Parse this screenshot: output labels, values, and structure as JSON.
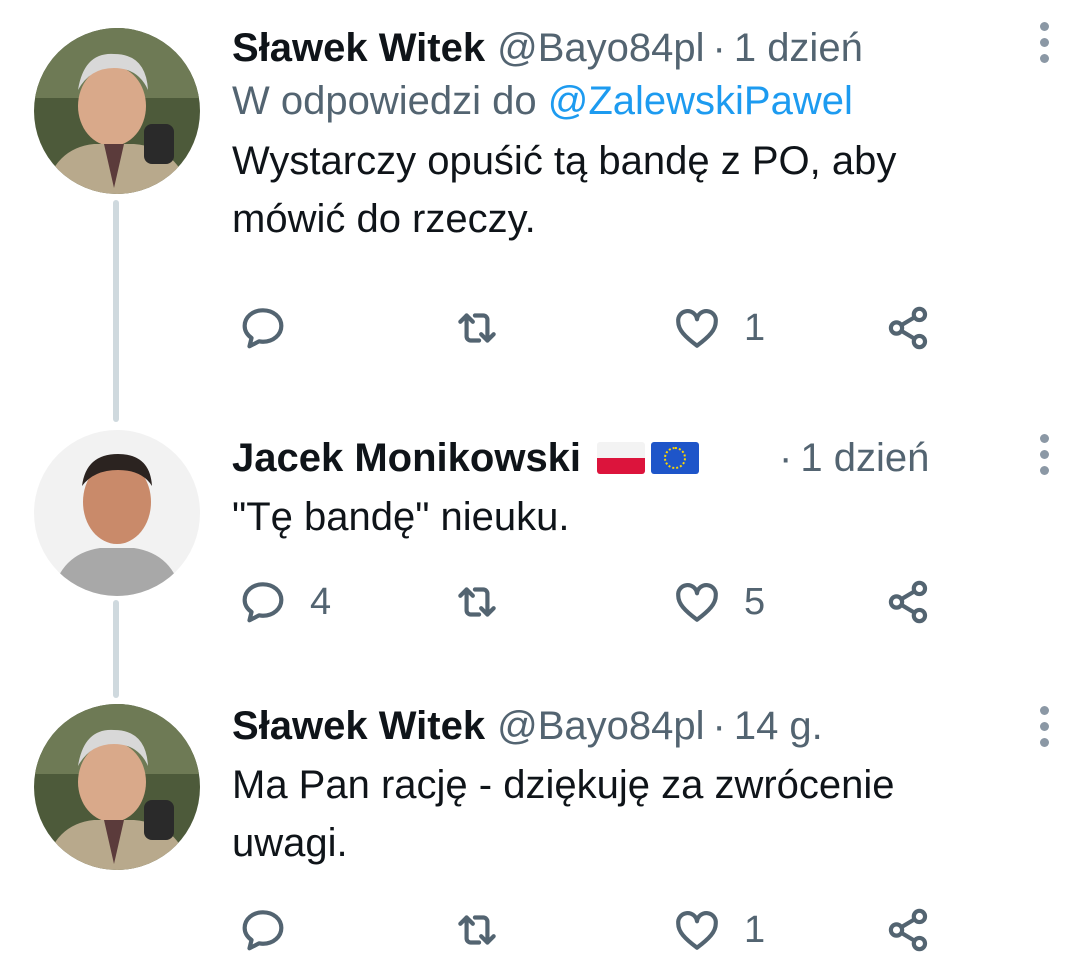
{
  "tweets": [
    {
      "name": "Sławek Witek",
      "handle": "@Bayo84pl",
      "time": "1 dzień",
      "reply_prefix": "W odpowiedzi do",
      "reply_mention": "@ZalewskiPawel",
      "text": "Wystarczy opuśić tą bandę z PO, aby\nmówić do rzeczy.",
      "counts": {
        "reply": "",
        "retweet": "",
        "like": "1"
      }
    },
    {
      "name": "Jacek Monikowski",
      "flags": [
        "flag-poland-icon",
        "flag-eu-icon"
      ],
      "time": "1 dzień",
      "text": "\"Tę bandę\" nieuku.",
      "counts": {
        "reply": "4",
        "retweet": "",
        "like": "5"
      }
    },
    {
      "name": "Sławek Witek",
      "handle": "@Bayo84pl",
      "time": "14 g.",
      "text": "Ma Pan rację - dziękuję za zwrócenie\nuwagi.",
      "counts": {
        "reply": "",
        "retweet": "",
        "like": "1"
      }
    }
  ],
  "separator": "·",
  "colors": {
    "text": "#0f1419",
    "secondary": "#536471",
    "link": "#1d9bf0",
    "thread_line": "#cfd9de"
  }
}
